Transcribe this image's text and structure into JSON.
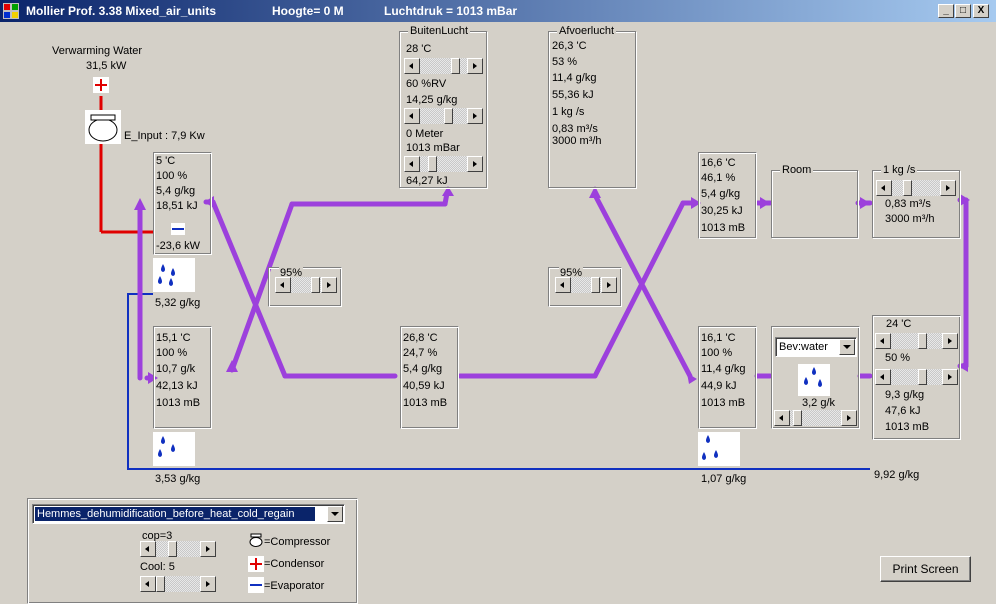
{
  "window": {
    "app_title": "Mollier Prof. 3.38  Mixed_air_units",
    "altitude": "Hoogte= 0  M",
    "pressure": "Luchtdruk = 1013 mBar",
    "minimize": "_",
    "maximize": "□",
    "close": "X"
  },
  "heating": {
    "title": "Verwarming Water",
    "power": "31,5 kW",
    "e_input": "E_Input : 7,9 Kw"
  },
  "cooler": {
    "temp": "5 'C",
    "rh": "100 %",
    "x": "5,4 g/kg",
    "h": "18,51 kJ",
    "power": "-23,6 kW",
    "condensate": "5,32 g/kg"
  },
  "buitenlucht": {
    "legend": "BuitenLucht",
    "temp": "28 'C",
    "rh": "60 %RV",
    "x": "14,25 g/kg",
    "height": "0 Meter",
    "pressure": "1013 mBar",
    "h": "64,27 kJ"
  },
  "afvoerlucht": {
    "legend": "Afvoerlucht",
    "temp": "26,3 'C",
    "rh": "53 %",
    "x": "11,4 g/kg",
    "h": "55,36 kJ",
    "flow_kg": "1 kg /s",
    "flow_m3s": "0,83 m³/s",
    "flow_m3h": "3000 m³/h"
  },
  "hrx_left": {
    "eff": "95%"
  },
  "hrx_right": {
    "eff": "95%"
  },
  "reheat": {
    "temp": "15,1 'C",
    "rh": "100 %",
    "x": "10,7 g/k",
    "h": "42,13 kJ",
    "p": "1013 mB",
    "condensate": "3,53 g/kg"
  },
  "mid": {
    "temp": "26,8 'C",
    "rh": "24,7 %",
    "x": "5,4 g/kg",
    "h": "40,59 kJ",
    "p": "1013 mB"
  },
  "supply": {
    "temp": "16,6 'C",
    "rh": "46,1 %",
    "x": "5,4 g/kg",
    "h": "30,25 kJ",
    "p": "1013 mB"
  },
  "room": {
    "label": "Room"
  },
  "flow": {
    "kg": "1 kg /s",
    "m3s": "0,83 m³/s",
    "m3h": "3000 m³/h"
  },
  "room_out": {
    "temp": "24 'C",
    "rh": "50 %",
    "x": "9,3 g/kg",
    "h": "47,6 kJ",
    "p": "1013 mB"
  },
  "humidifier": {
    "select": "Bev:water",
    "rate": "3,2 g/k"
  },
  "exhaust_hx": {
    "temp": "16,1 'C",
    "rh": "100 %",
    "x": "11,4 g/kg",
    "h": "44,9 kJ",
    "p": "1013 mB",
    "condensate": "1,07 g/kg"
  },
  "total_condensate": "9,92 g/kg",
  "bottom_panel": {
    "scenario": "Hemmes_dehumidification_before_heat_cold_regain",
    "cop": "cop=3",
    "cool": "Cool: 5",
    "legend_compressor": "=Compressor",
    "legend_condensor": "=Condensor",
    "legend_evaporator": "=Evaporator"
  },
  "print_button": "Print Screen",
  "colors": {
    "process_line": "#9c40dc",
    "water_line": "#1030c0",
    "heating_line": "#e00000"
  }
}
